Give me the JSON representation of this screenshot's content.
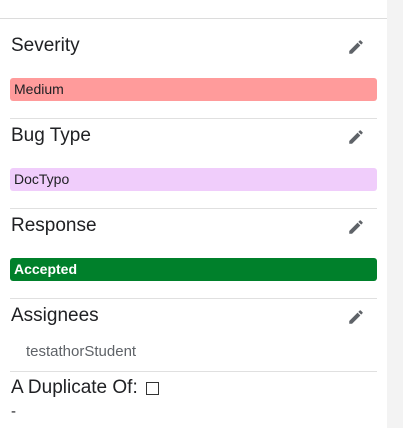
{
  "severity": {
    "title": "Severity",
    "value": "Medium",
    "color": "#ff9b9b"
  },
  "bug_type": {
    "title": "Bug Type",
    "value": "DocTypo",
    "color": "#f0cdfb"
  },
  "response": {
    "title": "Response",
    "value": "Accepted",
    "color": "#00802b"
  },
  "assignees": {
    "title": "Assignees",
    "names": [
      "testathorStudent"
    ]
  },
  "duplicate": {
    "title": "A Duplicate Of:",
    "checked": false,
    "value": "-"
  },
  "icons": {
    "edit": "pencil-icon"
  }
}
